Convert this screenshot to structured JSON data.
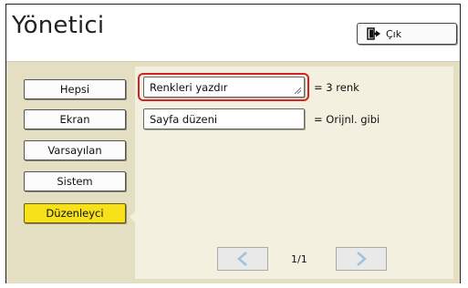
{
  "header": {
    "title": "Yönetici",
    "exit_label": "Çık"
  },
  "sidebar": {
    "items": [
      {
        "label": "Hepsi",
        "active": false
      },
      {
        "label": "Ekran",
        "active": false
      },
      {
        "label": "Varsayılan",
        "active": false
      },
      {
        "label": "Sistem",
        "active": false
      },
      {
        "label": "Düzenleyci",
        "active": true
      }
    ]
  },
  "settings": [
    {
      "label": "Renkleri yazdır",
      "value": "= 3 renk",
      "highlighted": true
    },
    {
      "label": "Sayfa düzeni",
      "value": "= Orijnl. gibi",
      "highlighted": false
    }
  ],
  "pager": {
    "page_indicator": "1/1",
    "prev_icon": "chevron-left-icon",
    "next_icon": "chevron-right-icon"
  },
  "colors": {
    "panel_bg": "#e4dfc3",
    "active_tab": "#f6e11a",
    "highlight": "#d6202a",
    "chevron": "#9fc3de"
  }
}
